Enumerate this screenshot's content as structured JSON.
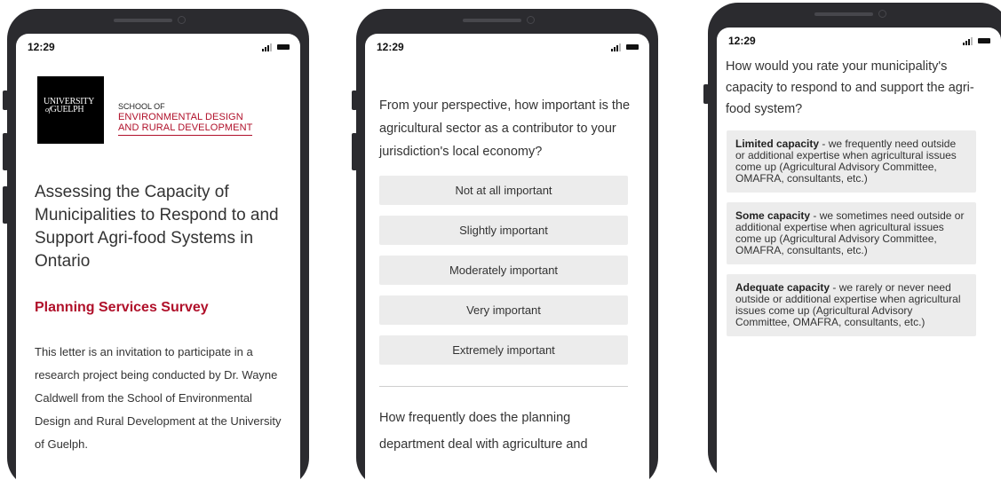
{
  "status_time": "12:29",
  "phone1": {
    "logo": [
      "UNIVERSITY",
      "GUELPH"
    ],
    "logo_prefix": "of",
    "dept_lines": [
      "SCHOOL OF",
      "ENVIRONMENTAL DESIGN",
      "AND RURAL DEVELOPMENT"
    ],
    "title": "Assessing the Capacity of Municipalities to Respond to and Support Agri-food Systems in Ontario",
    "subtitle": "Planning Services Survey",
    "body": "This letter is an invitation to participate in a research project being conducted by Dr. Wayne Caldwell from the School of Environmental Design and Rural Development at the University of Guelph."
  },
  "phone2": {
    "question": "From your perspective, how important is the agricultural sector as a contributor to your jurisdiction's local economy?",
    "options": [
      "Not at all important",
      "Slightly important",
      "Moderately important",
      "Very important",
      "Extremely important"
    ],
    "next_question": "How frequently does the planning department deal with agriculture and"
  },
  "phone3": {
    "question": "How would you rate your municipality's capacity to respond to and support the agri-food system?",
    "capacity_options": [
      {
        "label": "Limited capacity",
        "desc": " - we frequently need outside or additional expertise when agricultural issues come up (Agricultural Advisory Committee, OMAFRA, consultants, etc.)"
      },
      {
        "label": "Some capacity",
        "desc": " - we sometimes need outside or additional expertise when agricultural issues come up (Agricultural Advisory Committee, OMAFRA, consultants, etc.)"
      },
      {
        "label": "Adequate capacity",
        "desc": " - we rarely or never need outside or additional expertise when agricultural issues come up (Agricultural Advisory Committee, OMAFRA, consultants, etc.)"
      }
    ]
  },
  "colors": {
    "brand_red": "#b0102a",
    "option_bg": "#ececec",
    "phone_frame": "#2b2b2f"
  }
}
